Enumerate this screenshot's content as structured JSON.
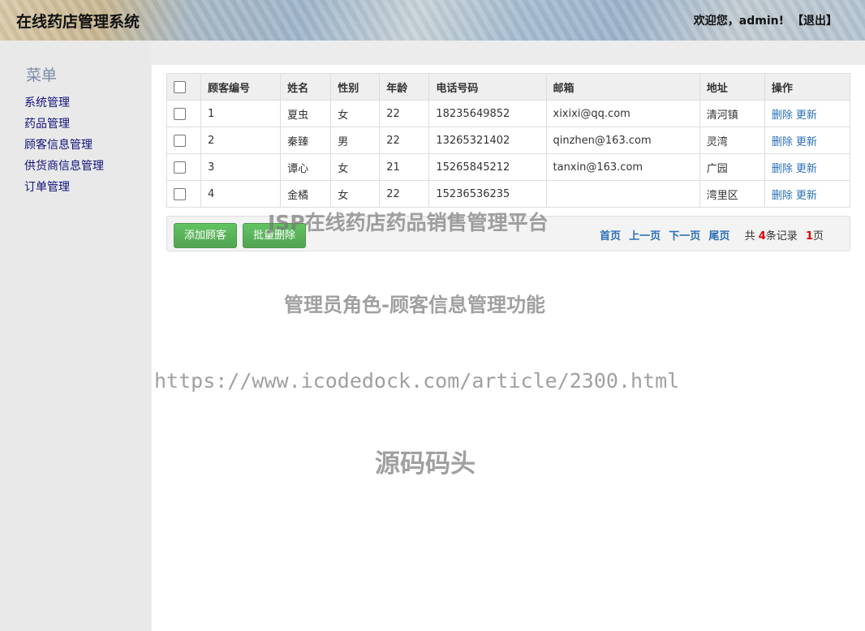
{
  "header": {
    "title": "在线药店管理系统",
    "welcome": "欢迎您，admin!",
    "logout": "【退出】"
  },
  "sidebar": {
    "title": "菜单",
    "items": [
      {
        "label": "系统管理"
      },
      {
        "label": "药品管理"
      },
      {
        "label": "顾客信息管理"
      },
      {
        "label": "供货商信息管理"
      },
      {
        "label": "订单管理"
      }
    ]
  },
  "table": {
    "headers": [
      "顾客编号",
      "姓名",
      "性别",
      "年龄",
      "电话号码",
      "邮箱",
      "地址",
      "操作"
    ],
    "rows": [
      {
        "id": "1",
        "name": "夏虫",
        "gender": "女",
        "age": "22",
        "phone": "18235649852",
        "email": "xixixi@qq.com",
        "address": "清河镇"
      },
      {
        "id": "2",
        "name": "秦臻",
        "gender": "男",
        "age": "22",
        "phone": "13265321402",
        "email": "qinzhen@163.com",
        "address": "灵湾"
      },
      {
        "id": "3",
        "name": "谭心",
        "gender": "女",
        "age": "21",
        "phone": "15265845212",
        "email": "tanxin@163.com",
        "address": "广园"
      },
      {
        "id": "4",
        "name": "金橘",
        "gender": "女",
        "age": "22",
        "phone": "15236536235",
        "email": "",
        "address": "湾里区"
      }
    ],
    "action_delete": "删除",
    "action_update": "更新"
  },
  "toolbar": {
    "add_label": "添加顾客",
    "batch_delete_label": "批量删除"
  },
  "pager": {
    "first": "首页",
    "prev": "上一页",
    "next": "下一页",
    "last": "尾页",
    "total_prefix": "共",
    "record_count": "4",
    "record_suffix": "条记录",
    "page_count": "1",
    "page_suffix": "页"
  },
  "watermarks": {
    "platform": "JSP在线药店药品销售管理平台",
    "feature": "管理员角色-顾客信息管理功能",
    "url": "https://www.icodedock.com/article/2300.html",
    "brand": "源码码头"
  },
  "colors": {
    "link": "#2a6fb8",
    "menu_link": "#10127a",
    "add_button": "#5cb85c",
    "count_highlight": "#dd0000"
  }
}
